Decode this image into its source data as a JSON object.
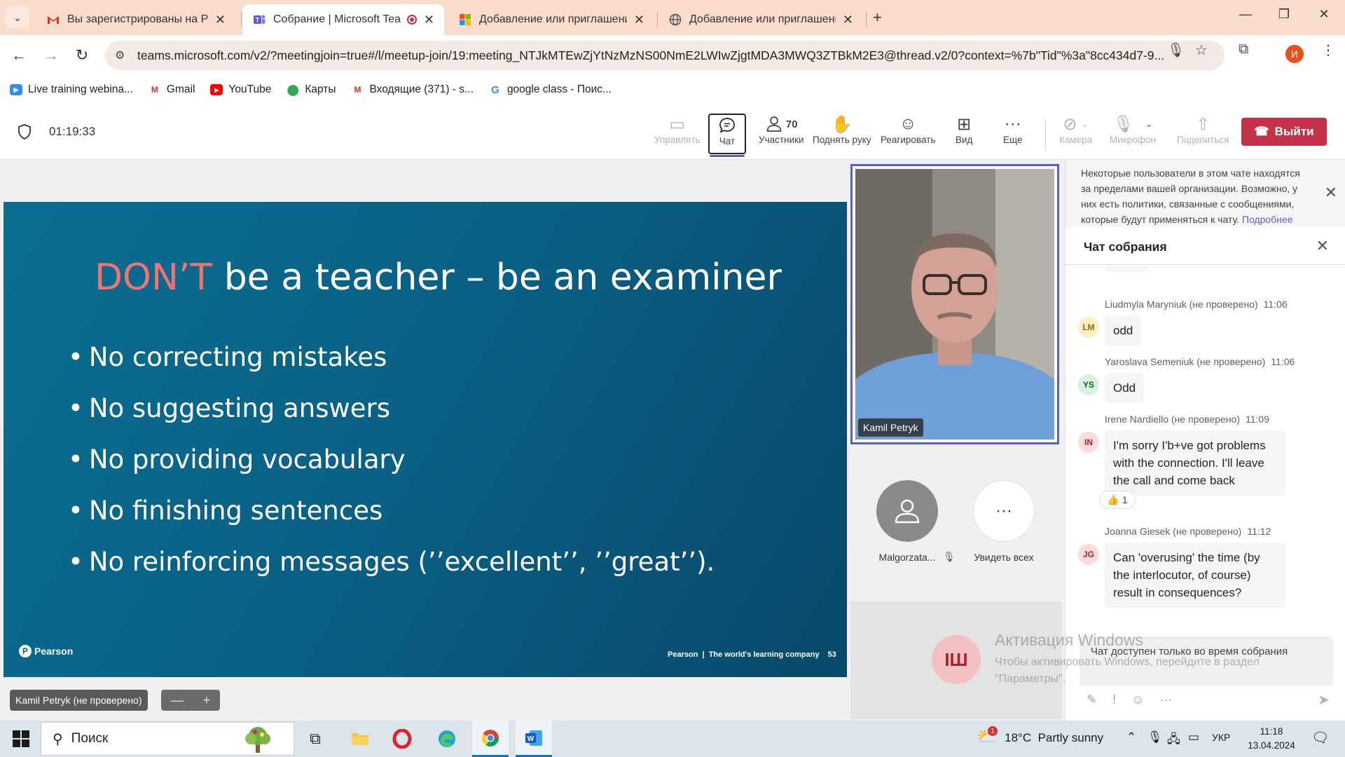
{
  "browser": {
    "tabs": [
      {
        "title": "Вы зарегистрированы на PEAR",
        "icon": "gmail-icon",
        "active": false
      },
      {
        "title": "Собрание | Microsoft Teams",
        "icon": "teams-icon",
        "active": true,
        "recording": true
      },
      {
        "title": "Добавление или приглашение",
        "icon": "microsoft-icon",
        "active": false
      },
      {
        "title": "Добавление или приглашение",
        "icon": "globe-icon",
        "active": false
      }
    ],
    "new_tab": "+",
    "url": "teams.microsoft.com/v2/?meetingjoin=true#/l/meetup-join/19:meeting_NTJkMTEwZjYtNzMzNS00NmE2LWIwZjgtMDA3MWQ3ZTBkM2E3@thread.v2/0?context=%7b\"Tid\"%3a\"8cc434d7-9...",
    "profile_initial": "И",
    "bookmarks": [
      {
        "label": "Live training webina...",
        "icon": "zoom-icon"
      },
      {
        "label": "Gmail",
        "icon": "gmail-icon"
      },
      {
        "label": "YouTube",
        "icon": "youtube-icon"
      },
      {
        "label": "Карты",
        "icon": "maps-icon"
      },
      {
        "label": "Входящие (371) - s...",
        "icon": "gmail-icon"
      },
      {
        "label": "google class - Поис...",
        "icon": "google-icon"
      }
    ]
  },
  "meeting": {
    "timer": "01:19:33",
    "toolbar": {
      "manage": "Управлять",
      "chat": "Чат",
      "participants_count": "70",
      "participants": "Участники",
      "raise_hand": "Поднять руку",
      "react": "Реагировать",
      "view": "Вид",
      "more": "Еще",
      "camera": "Камера",
      "mic": "Микрофон",
      "share": "Поделиться",
      "leave": "Выйти"
    }
  },
  "slide": {
    "title_highlight": "DON’T",
    "title_rest": "be a teacher – be an examiner",
    "bullets": [
      "No correcting mistakes",
      "No suggesting answers",
      "No providing vocabulary",
      "No finishing sentences",
      "No reinforcing messages (’’excellent’’, ’’great’’)."
    ],
    "logo": "Pearson",
    "footer": "Pearson  |  The world's learning company",
    "page": "53"
  },
  "stage": {
    "presenter_label": "Kamil Petryk (не проверено)",
    "zoom_minus": "—",
    "zoom_plus": "+"
  },
  "participants": {
    "video_name": "Kamil Petryk",
    "tile1_name": "Malgorzata...",
    "tile2_label": "Увидеть всех",
    "bottom_initials": "ІШ"
  },
  "watermark": {
    "line1": "Активация Windows",
    "line2": "Чтобы активировать Windows, перейдите в раздел",
    "line3": "\"Параметры\"."
  },
  "chat": {
    "notice": "Некоторые пользователи в этом чате находятся за пределами вашей организации. Возможно, у них есть политики, связанные с сообщениями, которые будут применяться к чату.",
    "notice_link": "Подробнее",
    "title": "Чат собрания",
    "messages": [
      {
        "author": "Liudmyla Maryniuk (не проверено)",
        "time": "11:06",
        "initials": "LM",
        "text": "odd",
        "avatar_bg": "#fcefc6",
        "avatar_fg": "#8a6d00"
      },
      {
        "author": "Yaroslava Semeniuk (не проверено)",
        "time": "11:06",
        "initials": "YS",
        "text": "Odd",
        "avatar_bg": "#dcefe2",
        "avatar_fg": "#0b6a0b"
      },
      {
        "author": "Irene Nardiello (не проверено)",
        "time": "11:09",
        "initials": "IN",
        "text": "I'm sorry I'b+ve got problems with the connection. I'll leave the call and come back",
        "avatar_bg": "#fadddf",
        "avatar_fg": "#a4262c",
        "reaction_emoji": "👍",
        "reaction_count": "1"
      },
      {
        "author": "Joanna Giesek (не проверено)",
        "time": "11:12",
        "initials": "JG",
        "text": "Can 'overusing' the time (by the interlocutor, of course) result in consequences?",
        "avatar_bg": "#fadddf",
        "avatar_fg": "#a4262c"
      }
    ],
    "compose_text": "Чат доступен только во время собрания"
  },
  "taskbar": {
    "search": "Поиск",
    "weather": "18°C  Partly sunny",
    "weather_badge": "1",
    "lang": "УКР",
    "time": "11:18",
    "date": "13.04.2024"
  },
  "colors": {
    "teams_accent": "#5b5fc7",
    "leave_red": "#c4314b",
    "slide_blue": "#0a5f84",
    "dont_pink": "#f07373"
  }
}
